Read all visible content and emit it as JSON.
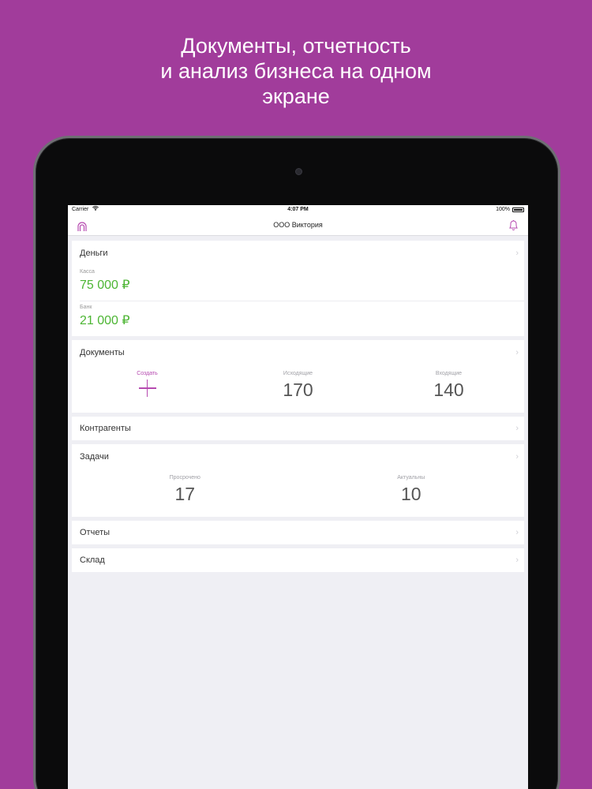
{
  "headline": {
    "line1": "Документы, отчетность",
    "line2": "и анализ бизнеса на одном",
    "line3": "экране"
  },
  "statusbar": {
    "carrier": "Carrier",
    "time": "4:07 PM",
    "battery": "100%"
  },
  "navbar": {
    "title": "ООО Виктория",
    "left_icon": "profile-icon",
    "right_icon": "bell-icon"
  },
  "money": {
    "title": "Деньги",
    "rows": [
      {
        "label": "Касса",
        "value": "75 000 ₽"
      },
      {
        "label": "Банк",
        "value": "21 000 ₽"
      }
    ]
  },
  "documents": {
    "title": "Документы",
    "create_label": "Создать",
    "outgoing_label": "Исходящие",
    "outgoing_value": "170",
    "incoming_label": "Входящие",
    "incoming_value": "140"
  },
  "contractors": {
    "title": "Контрагенты"
  },
  "tasks": {
    "title": "Задачи",
    "overdue_label": "Просрочено",
    "overdue_value": "17",
    "actual_label": "Актуальны",
    "actual_value": "10"
  },
  "reports": {
    "title": "Отчеты"
  },
  "warehouse": {
    "title": "Склад"
  },
  "colors": {
    "background": "#a13c9b",
    "accent": "#b64ab0",
    "money": "#4cb533"
  },
  "chevron": "›"
}
